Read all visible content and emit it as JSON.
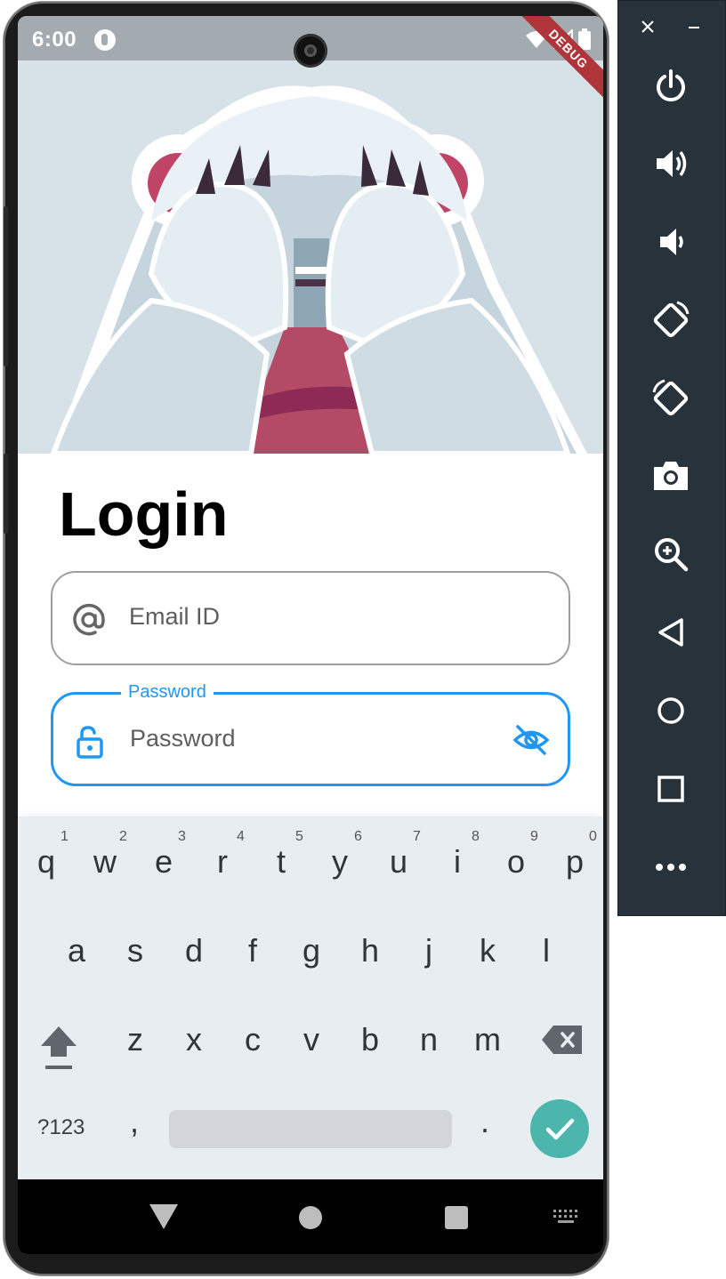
{
  "status_bar": {
    "time": "6:00",
    "debug_banner": "DEBUG",
    "icons": [
      "app-notification-icon",
      "wifi-icon",
      "signal-icon",
      "battery-icon"
    ]
  },
  "login": {
    "title": "Login",
    "email": {
      "placeholder": "Email ID",
      "icon": "at-icon"
    },
    "password": {
      "label": "Password",
      "placeholder": "Password",
      "icon": "unlock-icon",
      "toggle_icon": "visibility-off-icon"
    }
  },
  "keyboard": {
    "row1": [
      "q",
      "w",
      "e",
      "r",
      "t",
      "y",
      "u",
      "i",
      "o",
      "p"
    ],
    "row1_hints": [
      "1",
      "2",
      "3",
      "4",
      "5",
      "6",
      "7",
      "8",
      "9",
      "0"
    ],
    "row2": [
      "a",
      "s",
      "d",
      "f",
      "g",
      "h",
      "j",
      "k",
      "l"
    ],
    "row3": [
      "z",
      "x",
      "c",
      "v",
      "b",
      "n",
      "m"
    ],
    "symbols_label": "?123",
    "comma": ",",
    "period": ".",
    "shift_icon": "shift-icon",
    "backspace_icon": "backspace-icon",
    "enter_icon": "check-icon"
  },
  "navigation": {
    "icons": [
      "back-icon",
      "home-icon",
      "recents-icon",
      "keyboard-icon"
    ]
  },
  "emulator_controls": {
    "window_icons": [
      "close-icon",
      "minimize-icon"
    ],
    "buttons": [
      "power-icon",
      "volume-up-icon",
      "volume-down-icon",
      "rotate-left-icon",
      "rotate-right-icon",
      "camera-icon",
      "zoom-icon",
      "back-icon",
      "home-icon",
      "overview-icon",
      "more-icon"
    ]
  },
  "colors": {
    "accent": "#2196f3",
    "enter_key": "#4db6ac",
    "status_bar": "#a3aab0",
    "debug_banner": "#b0353a",
    "emulator_panel": "#28323a"
  }
}
